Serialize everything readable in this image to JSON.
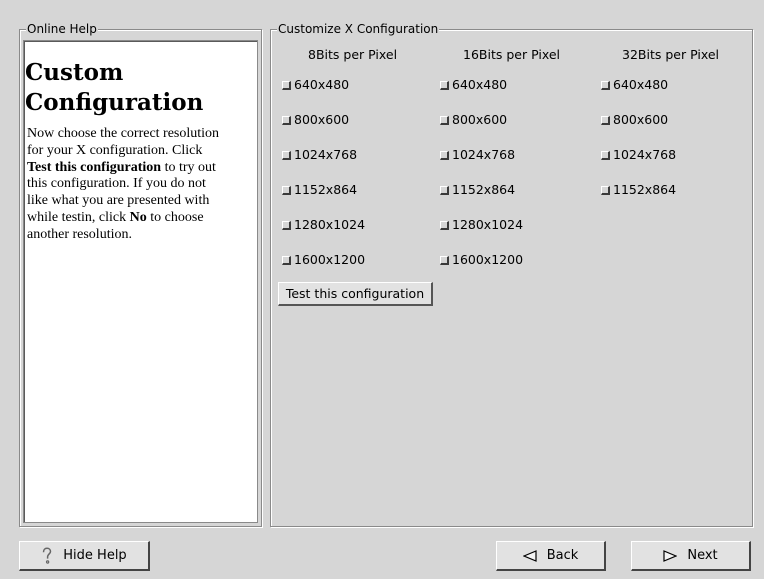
{
  "help": {
    "frame_title": "Online Help",
    "heading": "Custom Configuration",
    "body": {
      "p1": "Now choose the correct resolution for your X configuration. Click ",
      "b1": "Test this configuration",
      "p2": " to try out this configuration. If you do not like what you are presented with while testin, click ",
      "b2": "No",
      "p3": " to choose another resolution."
    }
  },
  "config": {
    "frame_title": "Customize X Configuration",
    "columns": [
      {
        "header": "8Bits per Pixel",
        "options": [
          "640x480",
          "800x600",
          "1024x768",
          "1152x864",
          "1280x1024",
          "1600x1200"
        ]
      },
      {
        "header": "16Bits per Pixel",
        "options": [
          "640x480",
          "800x600",
          "1024x768",
          "1152x864",
          "1280x1024",
          "1600x1200"
        ]
      },
      {
        "header": "32Bits per Pixel",
        "options": [
          "640x480",
          "800x600",
          "1024x768",
          "1152x864"
        ]
      }
    ],
    "test_button_label": "Test this configuration"
  },
  "nav": {
    "hide_help_label": "Hide Help",
    "back_label": "Back",
    "next_label": "Next"
  },
  "icons": {
    "hide_help": "question-mark-icon",
    "back": "left-triangle-icon",
    "next": "right-triangle-icon"
  }
}
